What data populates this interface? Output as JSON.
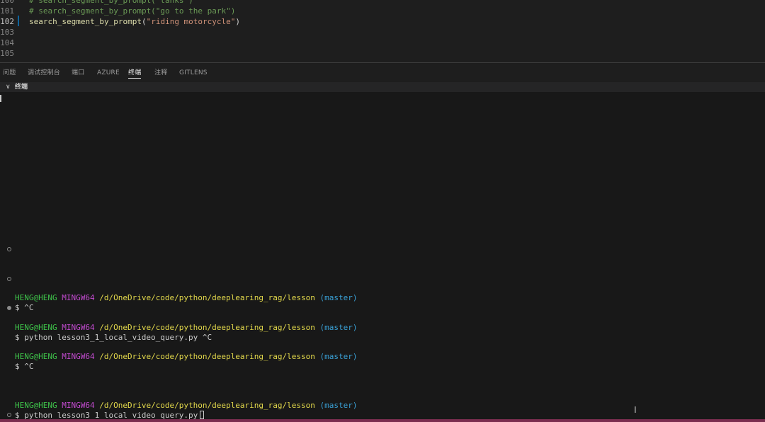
{
  "editor": {
    "lines": [
      {
        "number": "100",
        "parts": [
          [
            "cmt",
            "# search_segment_by_prompt(\"tanks\")"
          ]
        ]
      },
      {
        "number": "101",
        "parts": [
          [
            "cmt",
            "# search_segment_by_prompt(\"go to the park\")"
          ]
        ]
      },
      {
        "number": "102",
        "parts": [
          [
            "fn",
            "search_segment_by_prompt"
          ],
          [
            "punc",
            "("
          ],
          [
            "str",
            "\"riding motorcycle\""
          ],
          [
            "punc",
            ")"
          ]
        ]
      },
      {
        "number": "103",
        "parts": []
      },
      {
        "number": "104",
        "parts": []
      },
      {
        "number": "105",
        "parts": []
      }
    ]
  },
  "panel": {
    "tabs": [
      {
        "label": "问题",
        "active": false
      },
      {
        "label": "调试控制台",
        "active": false
      },
      {
        "label": "端口",
        "active": false
      },
      {
        "label": "AZURE",
        "active": false
      },
      {
        "label": "终端",
        "active": true
      },
      {
        "label": "注释",
        "active": false
      },
      {
        "label": "GITLENS",
        "active": false
      }
    ],
    "section_title": "终端"
  },
  "terminal": {
    "prompts": [
      {
        "user": "HENG@HENG",
        "host": "MINGW64",
        "path": "/d/OneDrive/code/python/deeplearing_rag/lesson",
        "branch": "(master)",
        "command": "$ ^C"
      },
      {
        "user": "HENG@HENG",
        "host": "MINGW64",
        "path": "/d/OneDrive/code/python/deeplearing_rag/lesson",
        "branch": "(master)",
        "command": "$ python lesson3_1_local_video_query.py ^C"
      },
      {
        "user": "HENG@HENG",
        "host": "MINGW64",
        "path": "/d/OneDrive/code/python/deeplearing_rag/lesson",
        "branch": "(master)",
        "command": "$ ^C"
      },
      {
        "user": "HENG@HENG",
        "host": "MINGW64",
        "path": "/d/OneDrive/code/python/deeplearing_rag/lesson",
        "branch": "(master)",
        "command": "$ python lesson3_1_local_video_query.py"
      }
    ]
  }
}
